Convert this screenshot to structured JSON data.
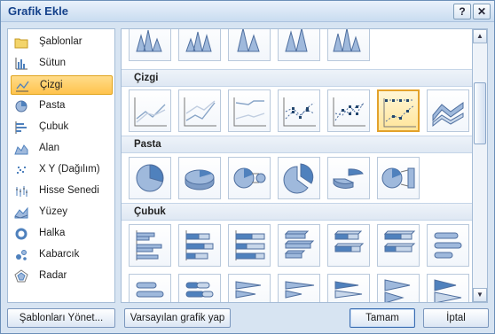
{
  "dialog": {
    "title": "Grafik Ekle",
    "help_glyph": "?",
    "close_glyph": "✕"
  },
  "categories": [
    {
      "label": "Şablonlar",
      "icon": "folder-icon"
    },
    {
      "label": "Sütun",
      "icon": "column-chart-icon"
    },
    {
      "label": "Çizgi",
      "icon": "line-chart-icon",
      "selected": true
    },
    {
      "label": "Pasta",
      "icon": "pie-chart-icon"
    },
    {
      "label": "Çubuk",
      "icon": "bar-chart-icon"
    },
    {
      "label": "Alan",
      "icon": "area-chart-icon"
    },
    {
      "label": "X Y (Dağılım)",
      "icon": "scatter-chart-icon"
    },
    {
      "label": "Hisse Senedi",
      "icon": "stock-chart-icon"
    },
    {
      "label": "Yüzey",
      "icon": "surface-chart-icon"
    },
    {
      "label": "Halka",
      "icon": "doughnut-chart-icon"
    },
    {
      "label": "Kabarcık",
      "icon": "bubble-chart-icon"
    },
    {
      "label": "Radar",
      "icon": "radar-chart-icon"
    }
  ],
  "gallery": {
    "sections": [
      {
        "title": "Çizgi"
      },
      {
        "title": "Pasta"
      },
      {
        "title": "Çubuk"
      }
    ],
    "selected_thumbnail": "line-with-markers-3"
  },
  "buttons": {
    "manage_templates": "Şablonları Yönet...",
    "set_default": "Varsayılan grafik yap",
    "ok": "Tamam",
    "cancel": "İptal"
  },
  "colors": {
    "accent_selection": "#ffc34d",
    "chart_blue": "#4f81bd",
    "chart_light": "#9fb9dc"
  }
}
